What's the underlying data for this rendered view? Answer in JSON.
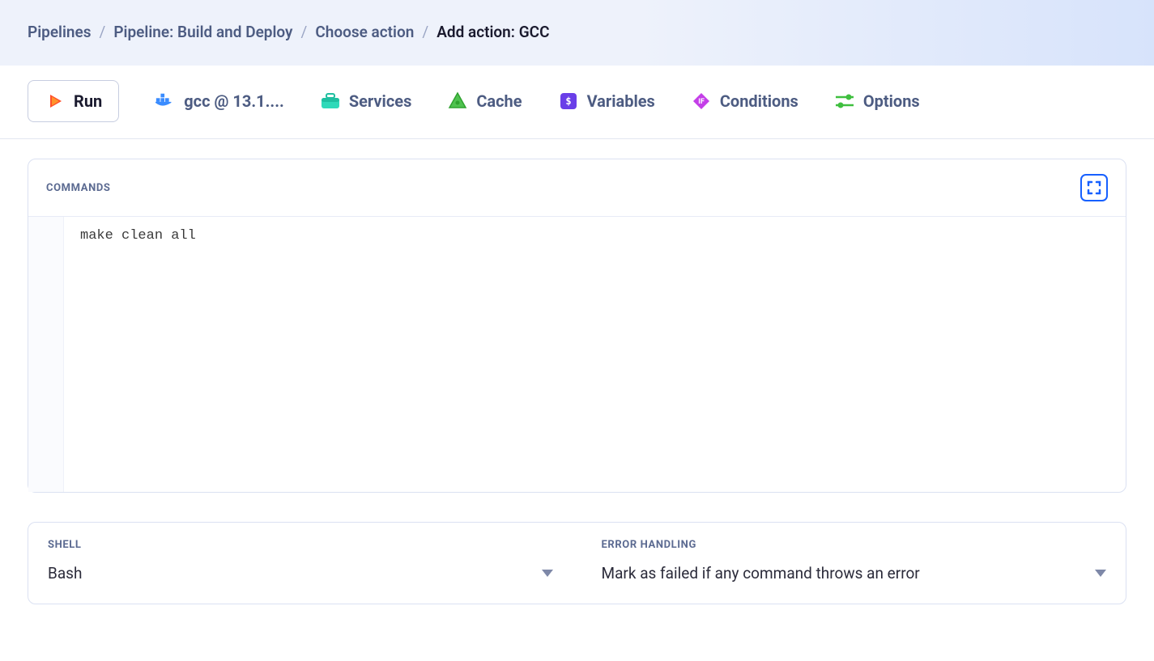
{
  "breadcrumb": {
    "items": [
      {
        "label": "Pipelines"
      },
      {
        "label": "Pipeline: Build and Deploy"
      },
      {
        "label": "Choose action"
      }
    ],
    "current": "Add action: GCC"
  },
  "tabs": {
    "run": "Run",
    "image": "gcc @ 13.1....",
    "services": "Services",
    "cache": "Cache",
    "variables": "Variables",
    "conditions": "Conditions",
    "options": "Options"
  },
  "commands": {
    "label": "COMMANDS",
    "code": "make clean all"
  },
  "shell": {
    "label": "SHELL",
    "value": "Bash"
  },
  "error_handling": {
    "label": "ERROR HANDLING",
    "value": "Mark as failed if any command throws an error"
  }
}
